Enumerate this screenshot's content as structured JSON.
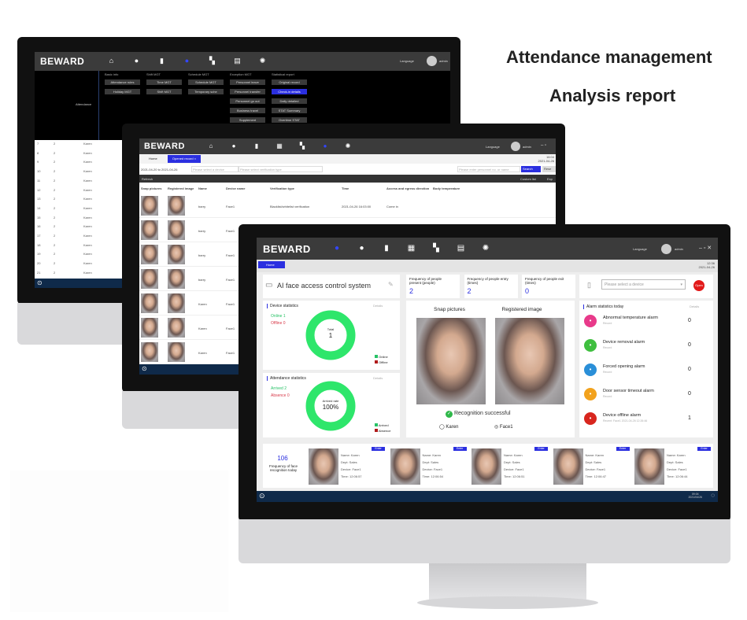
{
  "headline": {
    "line1": "Attendance management",
    "line2": "Analysis report"
  },
  "colors": {
    "accent": "#2b2fe0",
    "donut": "#2ee66b",
    "topbar": "#3b3b3b",
    "bottombar": "#0f2a4a",
    "online": "#27c266",
    "offline": "#d83a4a"
  },
  "brand": "BEWARD",
  "nav_icons": [
    "home-icon",
    "user-icon",
    "door-icon",
    "calendar-icon",
    "attendance-icon",
    "report-icon",
    "gear-icon"
  ],
  "language": "Language",
  "user": "admin",
  "screen1": {
    "side_label": "Attendance",
    "menu": [
      {
        "title": "Basic info",
        "items": [
          "Attendance rules",
          "Holiday MGT"
        ]
      },
      {
        "title": "Shift MGT",
        "items": [
          "Time MGT",
          "Shift MGT"
        ]
      },
      {
        "title": "Schedule MGT",
        "items": [
          "Schedule MGT",
          "Temporary sche"
        ]
      },
      {
        "title": "Exception MGT",
        "items": [
          "Personnel leave",
          "Personnel transfer",
          "Personnel go out",
          "Business travel",
          "Supplement"
        ]
      },
      {
        "title": "Statistical report",
        "items": [
          "Original record",
          "Check-in details",
          "Daily detailed",
          "STAT Summary",
          "Overtime STAT"
        ],
        "active": 1
      }
    ],
    "rows": [
      [
        "7",
        "2",
        "Karen"
      ],
      [
        "8",
        "2",
        "Karen"
      ],
      [
        "9",
        "2",
        "Karen"
      ],
      [
        "10",
        "2",
        "Karen"
      ],
      [
        "11",
        "2",
        "Karen"
      ],
      [
        "12",
        "2",
        "Karen"
      ],
      [
        "13",
        "2",
        "Karen"
      ],
      [
        "14",
        "2",
        "Karen"
      ],
      [
        "15",
        "2",
        "Karen"
      ],
      [
        "16",
        "2",
        "Karen"
      ],
      [
        "17",
        "2",
        "Karen"
      ],
      [
        "18",
        "2",
        "Karen"
      ],
      [
        "19",
        "2",
        "Karen"
      ],
      [
        "20",
        "2",
        "Karen"
      ],
      [
        "21",
        "2",
        "Karen"
      ]
    ]
  },
  "screen2": {
    "tabs": [
      "Home",
      "Opened record ×"
    ],
    "time": "16:04",
    "date": "2021-04-26",
    "date_range": "2021-04-20 to 2021-04-26",
    "device_placeholder": "Please select a device",
    "verification_placeholder": "Please select verification type",
    "search_placeholder": "Please enter personnel no. or name",
    "search_label": "Search",
    "reset_label": "Rese",
    "refresh_label": "Refresh",
    "custom_list": "Custom list",
    "export": "Exp",
    "columns": [
      "Snap pictures",
      "Registered image",
      "Name",
      "Device name",
      "Verification type",
      "Time",
      "Access and egress direction",
      "Body temperature"
    ],
    "rows": [
      {
        "name": "barry",
        "device": "Face1",
        "verification": "Blacklist/whitelist verification",
        "time": "2021-04-26 16:03:00",
        "direction": "Come in"
      },
      {
        "name": "barry",
        "device": "Face1"
      },
      {
        "name": "barry",
        "device": "Face1"
      },
      {
        "name": "barry",
        "device": "Face1"
      },
      {
        "name": "Karen",
        "device": "Face1"
      },
      {
        "name": "Karen",
        "device": "Face1"
      },
      {
        "name": "Karen",
        "device": "Face1"
      }
    ]
  },
  "screen3": {
    "home_tab": "Home",
    "time": "12:36",
    "date": "2021-04-26",
    "system_title": "AI face access control system",
    "freq": [
      {
        "label": "Frequency of people present (people)",
        "value": "2"
      },
      {
        "label": "Frequency of people entry (times)",
        "value": "2"
      },
      {
        "label": "Frequency of people exit (times)",
        "value": "0"
      }
    ],
    "device_placeholder": "Please select a device",
    "open_label": "Open",
    "device_stats": {
      "title": "Device statistics",
      "details": "Details",
      "online": "Online 1",
      "offline": "Offline 0",
      "center_label": "Total",
      "center_value": "1",
      "legend": [
        "Online",
        "Offline"
      ]
    },
    "attendance_stats": {
      "title": "Attendance statistics",
      "details": "Details",
      "arrived": "Arrived 2",
      "absence": "Absence 0",
      "center_label": "Arrived rate",
      "center_value": "100%",
      "rate": 1.0,
      "legend": [
        "Arrived",
        "Absence"
      ]
    },
    "recognition": {
      "snap_label": "Snap pictures",
      "registered_label": "Registered image",
      "status": "Recognition successful",
      "person": "Karen",
      "device": "Face1"
    },
    "alarms": {
      "title": "Alarm statistics today",
      "details": "Details",
      "items": [
        {
          "label": "Abnormal temperature alarm",
          "sub": "Record",
          "count": "0",
          "color": "#e83a8a",
          "icon": "thermometer-icon"
        },
        {
          "label": "Device removal alarm",
          "sub": "Record",
          "count": "0",
          "color": "#3fbf3f",
          "icon": "wrench-icon"
        },
        {
          "label": "Forced opening alarm",
          "sub": "Record",
          "count": "0",
          "color": "#2a8fd8",
          "icon": "lock-icon"
        },
        {
          "label": "Door sensor timeout alarm",
          "sub": "Record",
          "count": "0",
          "color": "#f2a21d",
          "icon": "clock-icon"
        },
        {
          "label": "Device offline alarm",
          "sub": "Recent: Face1 2021-04-26 12:26:46",
          "count": "1",
          "color": "#d8261e",
          "icon": "wifi-off-icon"
        }
      ]
    },
    "face_freq": {
      "value": "106",
      "label": "Frequency of face recognition today"
    },
    "records": [
      {
        "badge": "Enter",
        "name": "Name: Karen",
        "dept": "Dept: Sales",
        "device": "Device: Face1",
        "time": "Time: 12:06:57"
      },
      {
        "badge": "Enter",
        "name": "Name: Karen",
        "dept": "Dept: Sales",
        "device": "Device: Face1",
        "time": "Time: 12:06:54"
      },
      {
        "badge": "Enter",
        "name": "Name: Karen",
        "dept": "Dept: Sales",
        "device": "Device: Face1",
        "time": "Time: 12:06:51"
      },
      {
        "badge": "Enter",
        "name": "Name: Karen",
        "dept": "Dept: Sales",
        "device": "Device: Face1",
        "time": "Time: 12:06:47"
      },
      {
        "badge": "Enter",
        "name": "Name: Karen",
        "dept": "Dept: Sales",
        "device": "Device: Face1",
        "time": "Time: 12:06:44"
      }
    ],
    "footer_time": "09:04",
    "footer_date": "2021/04/26"
  }
}
